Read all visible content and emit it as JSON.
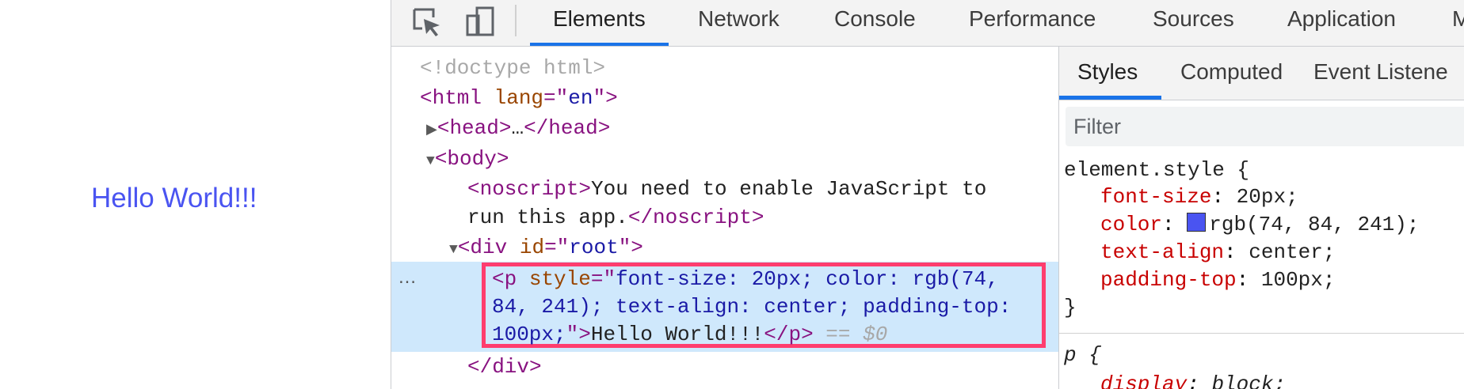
{
  "page": {
    "text": "Hello World!!!",
    "text_color": "#4a54f1"
  },
  "toolbar": {
    "icons": [
      "inspect-element-icon",
      "device-toolbar-icon"
    ],
    "tabs": [
      "Elements",
      "Network",
      "Console",
      "Performance",
      "Sources",
      "Application",
      "M"
    ],
    "active_tab": "Elements"
  },
  "dom": {
    "l1": "<!doctype html>",
    "l2_open": "<html",
    "l2_attr": "lang",
    "l2_eq": "=\"",
    "l2_val": "en",
    "l2_close": "\">",
    "l3_tri": "▶",
    "l3_open": "<head>",
    "l3_ellipsis": "…",
    "l3_close": "</head>",
    "l4_tri": "▼",
    "l4_tag": "<body>",
    "l5_open": "<noscript>",
    "l5_text": "You need to enable JavaScript to",
    "l6_text": "run this app.",
    "l6_close": "</noscript>",
    "l7_tri": "▼",
    "l7_open": "<div",
    "l7_attr": "id",
    "l7_eq": "=\"",
    "l7_val": "root",
    "l7_close": "\">",
    "dots": "…",
    "p_open": "<p",
    "p_attr": "style",
    "p_eq": "=\"",
    "p_val1": "font-size: 20px; color: rgb(74,",
    "p_val2": "84, 241); text-align: center; padding-top:",
    "p_val3": "100px;",
    "p_q": "\">",
    "p_text": "Hello World!!!",
    "p_close": "</p>",
    "p_eqeq": " == ",
    "p_dollar": "$0",
    "div_close": "</div>"
  },
  "styles": {
    "tabs": [
      "Styles",
      "Computed",
      "Event Listene"
    ],
    "active_tab": "Styles",
    "filter_placeholder": "Filter",
    "element_style": {
      "selector": "element.style {",
      "props": [
        {
          "name": "font-size",
          "value": "20px;"
        },
        {
          "name": "color",
          "value": "rgb(74, 84, 241);",
          "swatch": "#4a54f1"
        },
        {
          "name": "text-align",
          "value": "center;"
        },
        {
          "name": "padding-top",
          "value": "100px;"
        }
      ],
      "close": "}"
    },
    "p_rule": {
      "selector": "p {",
      "prop": "display",
      "value": "block;"
    }
  }
}
